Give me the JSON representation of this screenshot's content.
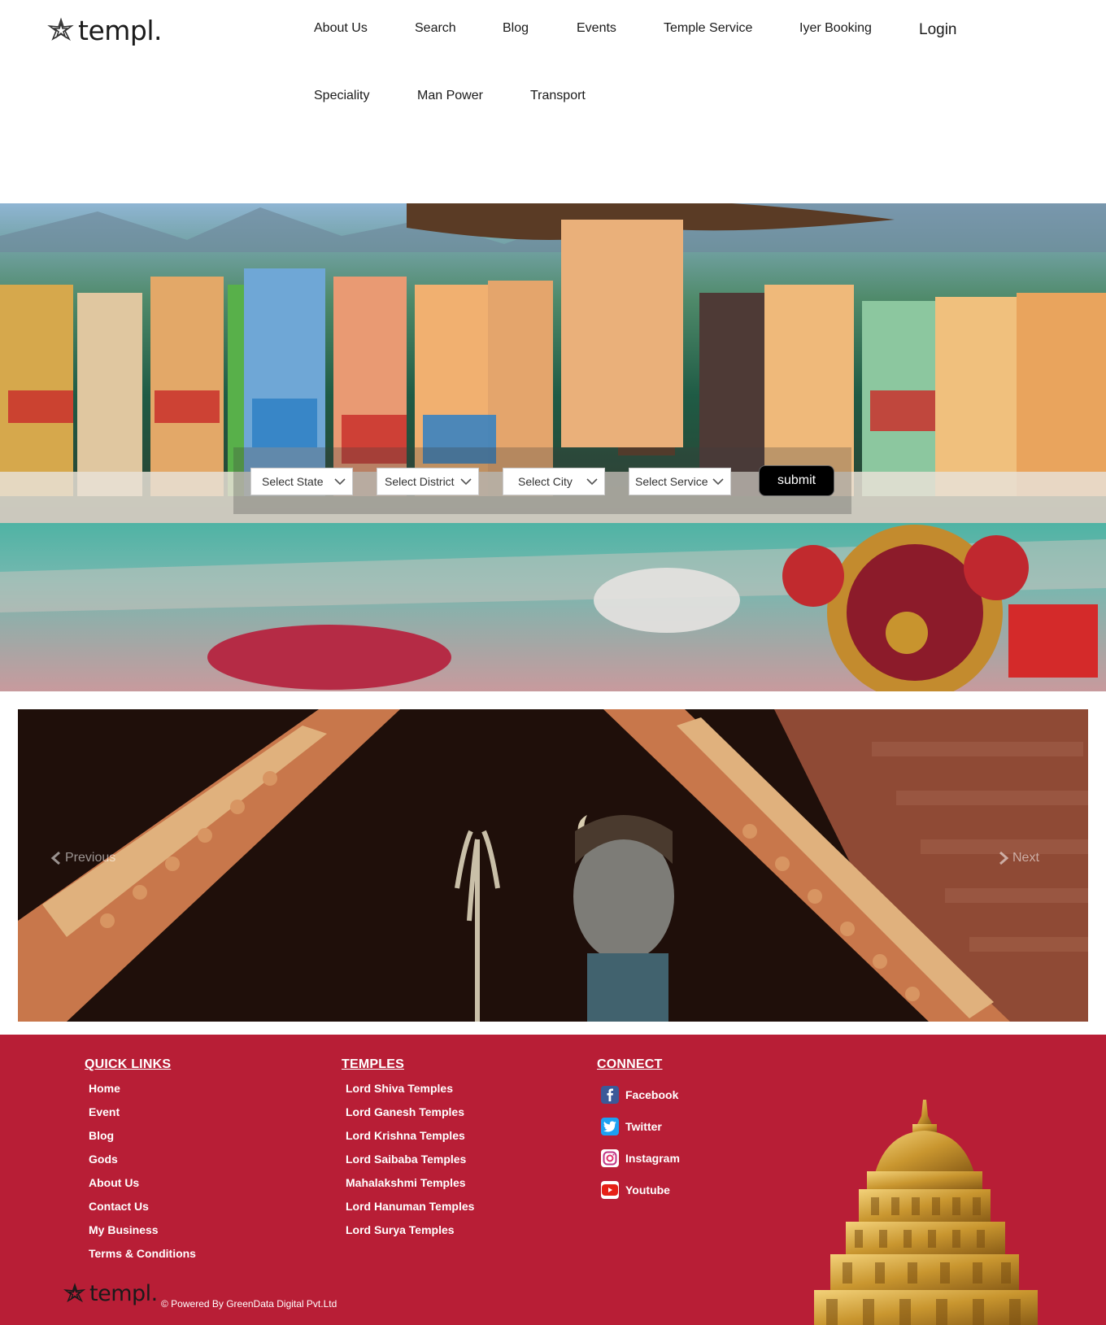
{
  "brand": {
    "name": "templ."
  },
  "nav": {
    "items": [
      "About Us",
      "Search",
      "Blog",
      "Events",
      "Temple Service",
      "Iyer Booking",
      "Speciality",
      "Man Power",
      "Transport"
    ],
    "login": "Login"
  },
  "search": {
    "state": "Select State",
    "district": "Select District",
    "city": "Select City",
    "service": "Select Service",
    "submit": "submit"
  },
  "carousel": {
    "previous": "Previous",
    "next": "Next"
  },
  "footer": {
    "quick_links": {
      "title": "QUICK LINKS",
      "items": [
        "Home",
        "Event",
        "Blog",
        "Gods",
        "About Us",
        "Contact Us",
        "My Business",
        "Terms & Conditions"
      ]
    },
    "temples": {
      "title": "TEMPLES",
      "items": [
        "Lord Shiva Temples",
        "Lord Ganesh Temples",
        "Lord Krishna Temples",
        "Lord Saibaba Temples",
        "Mahalakshmi Temples",
        "Lord Hanuman Temples",
        "Lord Surya Temples"
      ]
    },
    "connect": {
      "title": "CONNECT",
      "items": [
        {
          "label": "Facebook",
          "icon": "facebook-icon",
          "color": "#3b5998"
        },
        {
          "label": "Twitter",
          "icon": "twitter-icon",
          "color": "#1da1f2"
        },
        {
          "label": "Instagram",
          "icon": "instagram-icon",
          "color": "#c13584"
        },
        {
          "label": "Youtube",
          "icon": "youtube-icon",
          "color": "#e62117"
        }
      ]
    },
    "copyright": "© Powered By GreenData Digital Pvt.Ltd"
  },
  "colors": {
    "footer_bg": "#b81e36",
    "submit_bg": "#000000"
  }
}
